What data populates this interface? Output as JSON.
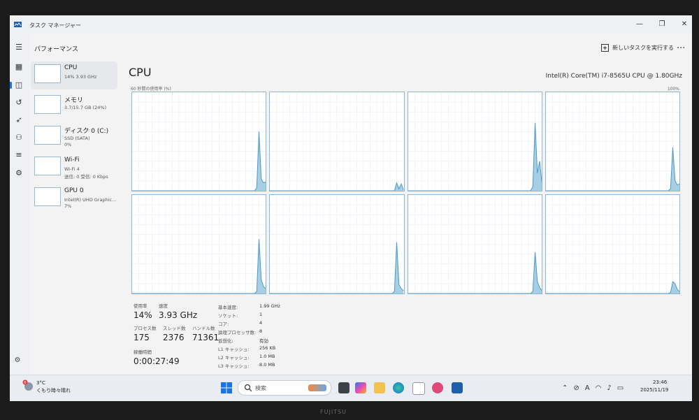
{
  "window": {
    "title": "タスク マネージャー"
  },
  "header": {
    "heading": "パフォーマンス",
    "run_new_task": "新しいタスクを実行する",
    "more": "..."
  },
  "resources": [
    {
      "name": "CPU",
      "detail": "14% 3.93 GHz",
      "selected": true
    },
    {
      "name": "メモリ",
      "detail": "3.7/15.7 GB (24%)",
      "selected": false
    },
    {
      "name": "ディスク 0 (C:)",
      "detail": "SSD (SATA)",
      "detail2": "0%",
      "selected": false
    },
    {
      "name": "Wi-Fi",
      "detail": "Wi-Fi 4",
      "detail2": "送信: 0 受信: 0 Kbps",
      "selected": false
    },
    {
      "name": "GPU 0",
      "detail": "Intel(R) UHD Graphic...",
      "detail2": "7%",
      "selected": false
    }
  ],
  "cpu": {
    "title": "CPU",
    "model": "Intel(R) Core(TM) i7-8565U CPU @ 1.80GHz",
    "chart_caption": "60 秒間の使用率 (%)",
    "chart_max": "100%",
    "accent": "#4d9ac8",
    "fill": "#a6cfe3",
    "stats": {
      "utilization_label": "使用率",
      "utilization": "14%",
      "speed_label": "速度",
      "speed": "3.93 GHz",
      "processes_label": "プロセス数",
      "processes": "175",
      "threads_label": "スレッド数",
      "threads": "2376",
      "handles_label": "ハンドル数",
      "handles": "71361",
      "uptime_label": "稼働時間",
      "uptime": "0:00:27:49"
    },
    "details": [
      {
        "k": "基本速度:",
        "v": "1.99 GHz"
      },
      {
        "k": "ソケット:",
        "v": "1"
      },
      {
        "k": "コア:",
        "v": "4"
      },
      {
        "k": "論理プロセッサ数:",
        "v": "8"
      },
      {
        "k": "仮想化:",
        "v": "有効"
      },
      {
        "k": "L1 キャッシュ:",
        "v": "256 KB"
      },
      {
        "k": "L2 キャッシュ:",
        "v": "1.0 MB"
      },
      {
        "k": "L3 キャッシュ:",
        "v": "8.0 MB"
      }
    ],
    "core_usage": [
      [
        0,
        0,
        0,
        0,
        0,
        0,
        0,
        0,
        0,
        0,
        0,
        0,
        0,
        0,
        0,
        0,
        0,
        0,
        0,
        0,
        0,
        0,
        0,
        0,
        0,
        0,
        0,
        0,
        0,
        0,
        0,
        0,
        0,
        0,
        0,
        0,
        0,
        0,
        0,
        0,
        0,
        0,
        0,
        0,
        0,
        0,
        0,
        0,
        0,
        0,
        0,
        0,
        0,
        0,
        0,
        3,
        60,
        12,
        8,
        9
      ],
      [
        0,
        0,
        0,
        0,
        0,
        0,
        0,
        0,
        0,
        0,
        0,
        0,
        0,
        0,
        0,
        0,
        0,
        0,
        0,
        0,
        0,
        0,
        0,
        0,
        0,
        0,
        0,
        0,
        0,
        0,
        0,
        0,
        0,
        0,
        0,
        0,
        0,
        0,
        0,
        0,
        0,
        0,
        0,
        0,
        0,
        0,
        0,
        0,
        0,
        0,
        0,
        0,
        0,
        0,
        0,
        0,
        8,
        2,
        7,
        1
      ],
      [
        0,
        0,
        0,
        0,
        0,
        0,
        0,
        0,
        0,
        0,
        0,
        0,
        0,
        0,
        0,
        0,
        0,
        0,
        0,
        0,
        0,
        0,
        0,
        0,
        0,
        0,
        0,
        0,
        0,
        0,
        0,
        0,
        0,
        0,
        0,
        0,
        0,
        0,
        0,
        0,
        0,
        0,
        0,
        0,
        0,
        0,
        0,
        0,
        0,
        0,
        0,
        0,
        0,
        0,
        0,
        4,
        69,
        18,
        30,
        8
      ],
      [
        0,
        0,
        0,
        0,
        0,
        0,
        0,
        0,
        0,
        0,
        0,
        0,
        0,
        0,
        0,
        0,
        0,
        0,
        0,
        0,
        0,
        0,
        0,
        0,
        0,
        0,
        0,
        0,
        0,
        0,
        0,
        0,
        0,
        0,
        0,
        0,
        0,
        0,
        0,
        0,
        0,
        0,
        0,
        0,
        0,
        0,
        0,
        0,
        0,
        0,
        0,
        0,
        0,
        0,
        0,
        2,
        44,
        10,
        6,
        7
      ],
      [
        0,
        0,
        0,
        0,
        0,
        0,
        0,
        0,
        0,
        0,
        0,
        0,
        0,
        0,
        0,
        0,
        0,
        0,
        0,
        0,
        0,
        0,
        0,
        0,
        0,
        0,
        0,
        0,
        0,
        0,
        0,
        0,
        0,
        0,
        0,
        0,
        0,
        0,
        0,
        0,
        0,
        0,
        0,
        0,
        0,
        0,
        0,
        0,
        0,
        0,
        0,
        0,
        0,
        0,
        0,
        2,
        55,
        14,
        7,
        5
      ],
      [
        0,
        0,
        0,
        0,
        0,
        0,
        0,
        0,
        0,
        0,
        0,
        0,
        0,
        0,
        0,
        0,
        0,
        0,
        0,
        0,
        0,
        0,
        0,
        0,
        0,
        0,
        0,
        0,
        0,
        0,
        0,
        0,
        0,
        0,
        0,
        0,
        0,
        0,
        0,
        0,
        0,
        0,
        0,
        0,
        0,
        0,
        0,
        0,
        0,
        0,
        0,
        0,
        0,
        0,
        0,
        2,
        52,
        9,
        5,
        3
      ],
      [
        0,
        0,
        0,
        0,
        0,
        0,
        0,
        0,
        0,
        0,
        0,
        0,
        0,
        0,
        0,
        0,
        0,
        0,
        0,
        0,
        0,
        0,
        0,
        0,
        0,
        0,
        0,
        0,
        0,
        0,
        0,
        0,
        0,
        0,
        0,
        0,
        0,
        0,
        0,
        0,
        0,
        0,
        0,
        0,
        0,
        0,
        0,
        0,
        0,
        0,
        0,
        0,
        0,
        0,
        0,
        2,
        42,
        12,
        6,
        3
      ],
      [
        0,
        0,
        0,
        0,
        0,
        0,
        0,
        0,
        0,
        0,
        0,
        0,
        0,
        0,
        0,
        0,
        0,
        0,
        0,
        0,
        0,
        0,
        0,
        0,
        0,
        0,
        0,
        0,
        0,
        0,
        0,
        0,
        0,
        0,
        0,
        0,
        0,
        0,
        0,
        0,
        0,
        0,
        0,
        0,
        0,
        0,
        0,
        0,
        0,
        0,
        0,
        0,
        0,
        0,
        0,
        1,
        12,
        10,
        4,
        2
      ]
    ]
  },
  "taskbar": {
    "weather_temp": "3°C",
    "weather_desc": "くもり時々晴れ",
    "weather_badge": "6",
    "search_placeholder": "検索",
    "time": "23:46",
    "date": "2025/11/19",
    "ime": "A",
    "apps": [
      "task-view",
      "copilot",
      "file-explorer",
      "edge",
      "calendar",
      "media-player",
      "task-manager"
    ]
  },
  "device_brand": "FUJITSU"
}
